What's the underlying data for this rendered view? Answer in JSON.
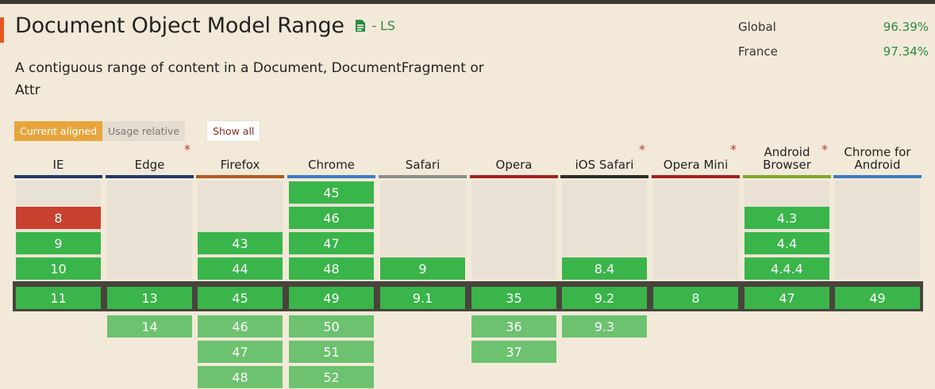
{
  "feature": {
    "title": "Document Object Model Range",
    "status": "- LS",
    "description": "A contiguous range of content in a Document, DocumentFragment or Attr",
    "doc_icon": "document-icon"
  },
  "usage": [
    {
      "label": "Global",
      "value": "96.39%"
    },
    {
      "label": "France",
      "value": "97.34%"
    }
  ],
  "controls": {
    "current_aligned": "Current aligned",
    "usage_relative": "Usage relative",
    "show_all": "Show all"
  },
  "colors": {
    "supported": "#39b54a",
    "not_supported": "#c8412f",
    "future": "#6cc26f",
    "current_frame": "#48433c",
    "accent": "#e8561f"
  },
  "browsers": [
    {
      "name": "IE",
      "bar": "#1e3a6e",
      "note": false,
      "past": [
        null,
        "8",
        "9",
        "10"
      ],
      "past_status": [
        null,
        "n",
        "y",
        "y"
      ],
      "current": "11",
      "future": [
        null,
        null,
        null
      ]
    },
    {
      "name": "Edge",
      "bar": "#1e3a6e",
      "note": true,
      "past": [
        null,
        null,
        null,
        null
      ],
      "past_status": [
        null,
        null,
        null,
        null
      ],
      "current": "13",
      "future": [
        "14",
        null,
        null
      ]
    },
    {
      "name": "Firefox",
      "bar": "#b05a1f",
      "note": false,
      "past": [
        null,
        null,
        "43",
        "44"
      ],
      "past_status": [
        null,
        null,
        "y",
        "y"
      ],
      "current": "45",
      "future": [
        "46",
        "47",
        "48"
      ]
    },
    {
      "name": "Chrome",
      "bar": "#3d7bc4",
      "note": false,
      "past": [
        "45",
        "46",
        "47",
        "48"
      ],
      "past_status": [
        "y",
        "y",
        "y",
        "y"
      ],
      "current": "49",
      "future": [
        "50",
        "51",
        "52"
      ]
    },
    {
      "name": "Safari",
      "bar": "#8c8c8c",
      "note": false,
      "past": [
        null,
        null,
        null,
        "9"
      ],
      "past_status": [
        null,
        null,
        null,
        "y"
      ],
      "current": "9.1",
      "future": [
        null,
        null,
        null
      ]
    },
    {
      "name": "Opera",
      "bar": "#a31f1f",
      "note": false,
      "past": [
        null,
        null,
        null,
        null
      ],
      "past_status": [
        null,
        null,
        null,
        null
      ],
      "current": "35",
      "future": [
        "36",
        "37",
        null
      ]
    },
    {
      "name": "iOS Safari",
      "bar": "#2b2b2b",
      "note": true,
      "past": [
        null,
        null,
        null,
        "8.4"
      ],
      "past_status": [
        null,
        null,
        null,
        "y"
      ],
      "current": "9.2",
      "future": [
        "9.3",
        null,
        null
      ]
    },
    {
      "name": "Opera Mini",
      "bar": "#a31f1f",
      "note": true,
      "past": [
        null,
        null,
        null,
        null
      ],
      "past_status": [
        null,
        null,
        null,
        null
      ],
      "current": "8",
      "future": [
        null,
        null,
        null
      ]
    },
    {
      "name": "Android Browser",
      "bar": "#7fa62d",
      "note": true,
      "past": [
        null,
        "4.3",
        "4.4",
        "4.4.4"
      ],
      "past_status": [
        null,
        "y",
        "y",
        "y"
      ],
      "current": "47",
      "future": [
        null,
        null,
        null
      ]
    },
    {
      "name": "Chrome for Android",
      "bar": "#3d7bc4",
      "note": false,
      "past": [
        null,
        null,
        null,
        null
      ],
      "past_status": [
        null,
        null,
        null,
        null
      ],
      "current": "49",
      "future": [
        null,
        null,
        null
      ]
    }
  ]
}
